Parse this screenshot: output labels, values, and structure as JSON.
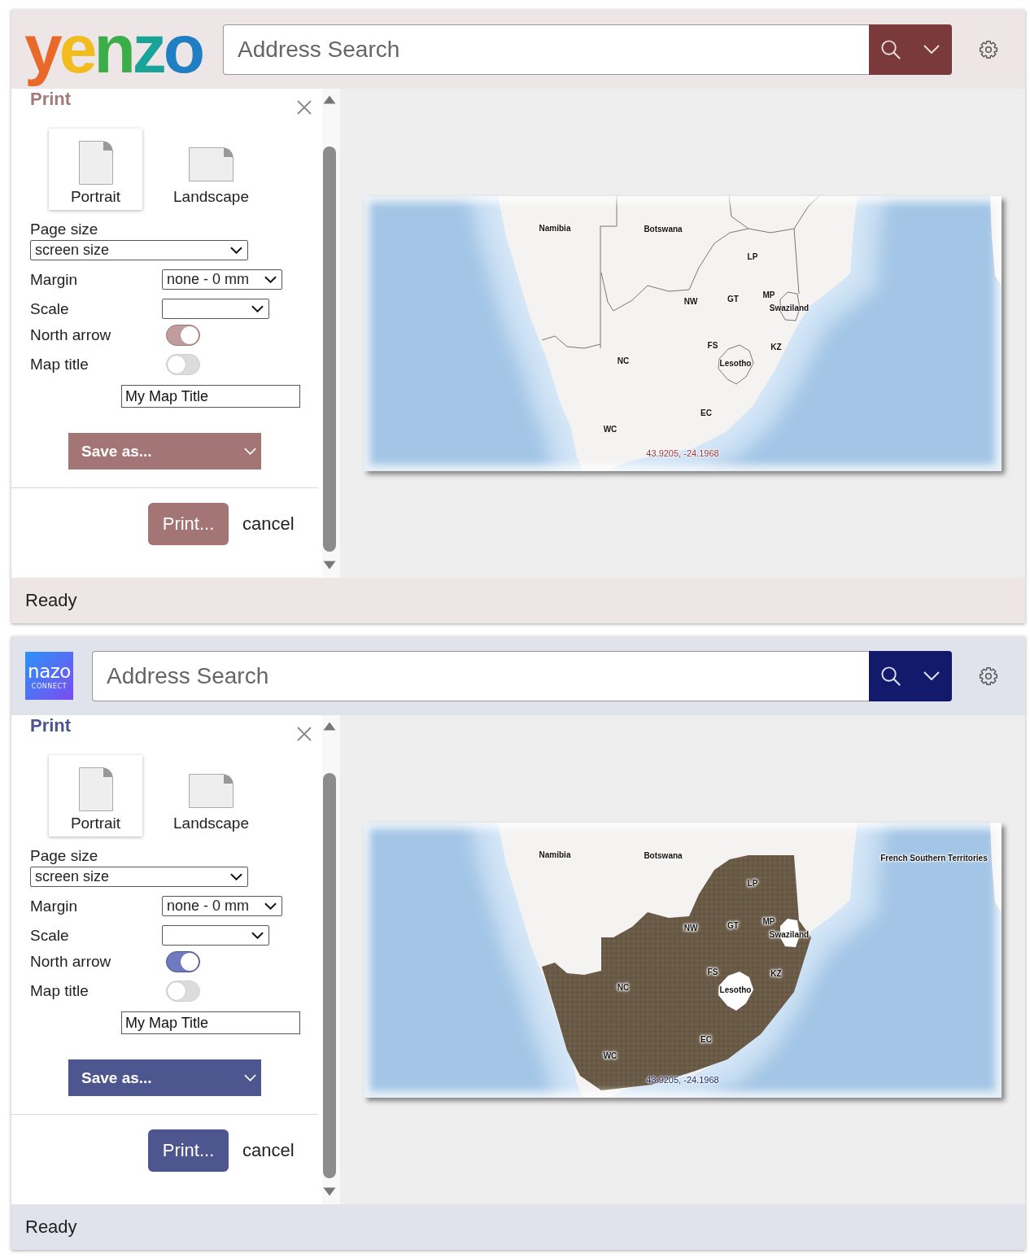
{
  "apps": [
    {
      "logo": {
        "kind": "wordmark",
        "text": "yenzo"
      },
      "search": {
        "placeholder": "Address Search"
      },
      "print_panel": {
        "title": "Print",
        "orientations": [
          {
            "label": "Portrait",
            "selected": true
          },
          {
            "label": "Landscape",
            "selected": false
          }
        ],
        "page_size": {
          "label": "Page size",
          "value": "screen size"
        },
        "margin": {
          "label": "Margin",
          "value": "none - 0 mm"
        },
        "scale": {
          "label": "Scale"
        },
        "north_arrow": {
          "label": "North arrow",
          "on": true
        },
        "map_title": {
          "label": "Map title",
          "on": false
        },
        "title_field": {
          "value": "My Map Title"
        },
        "save_button": "Save as...",
        "print_button": "Print...",
        "cancel_link": "cancel"
      },
      "map_preview": {
        "imagery": false,
        "labels": [
          "Namibia",
          "Botswana",
          "LP",
          "MP",
          "Swaziland",
          "NW",
          "GT",
          "FS",
          "KZ",
          "Lesotho",
          "NC",
          "EC",
          "WC"
        ],
        "coordinates": "43.9205, -24.1968"
      },
      "status_bar": "Ready"
    },
    {
      "logo": {
        "kind": "tile",
        "text": "nazo",
        "subtext": "CONNECT"
      },
      "search": {
        "placeholder": "Address Search"
      },
      "print_panel": {
        "title": "Print",
        "orientations": [
          {
            "label": "Portrait",
            "selected": true
          },
          {
            "label": "Landscape",
            "selected": false
          }
        ],
        "page_size": {
          "label": "Page size",
          "value": "screen size"
        },
        "margin": {
          "label": "Margin",
          "value": "none - 0 mm"
        },
        "scale": {
          "label": "Scale"
        },
        "north_arrow": {
          "label": "North arrow",
          "on": true
        },
        "map_title": {
          "label": "Map title",
          "on": false
        },
        "title_field": {
          "value": "My Map Title"
        },
        "save_button": "Save as...",
        "print_button": "Print...",
        "cancel_link": "cancel"
      },
      "map_preview": {
        "imagery": true,
        "labels": [
          "Namibia",
          "Botswana",
          "LP",
          "MP",
          "Swaziland",
          "NW",
          "GT",
          "FS",
          "KZ",
          "Lesotho",
          "NC",
          "EC",
          "WC",
          "French Southern Territories"
        ],
        "coordinates": "43.9205, -24.1968"
      },
      "status_bar": "Ready"
    }
  ]
}
